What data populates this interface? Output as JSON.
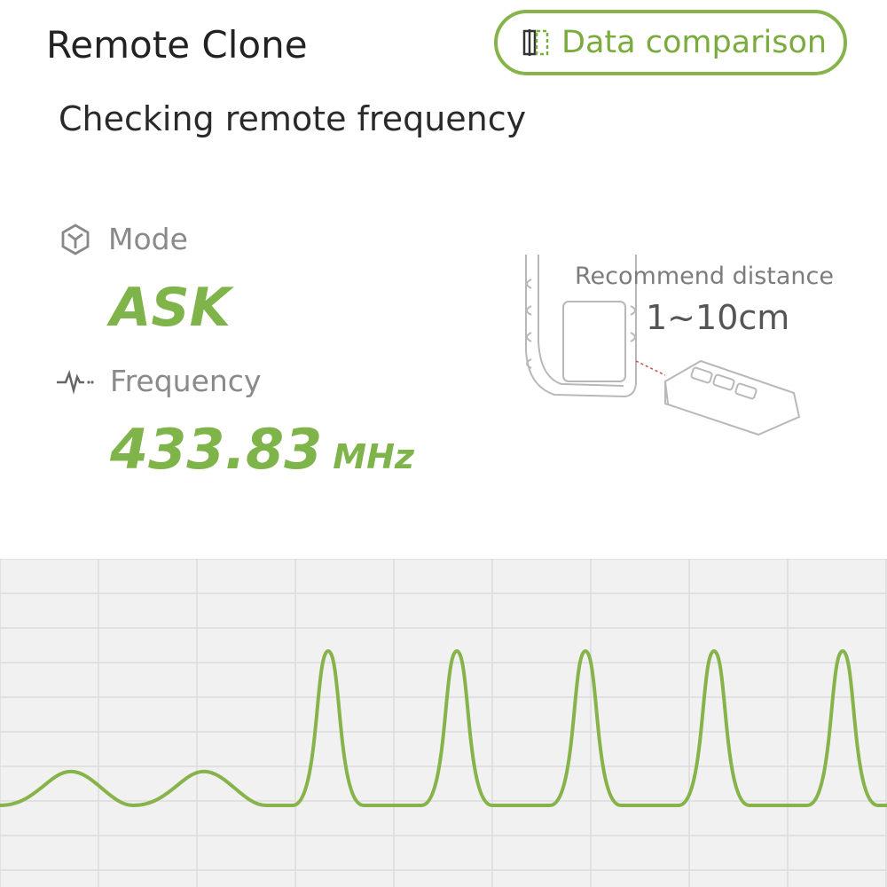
{
  "header": {
    "title": "Remote Clone",
    "compare_label": "Data comparison",
    "compare_icon": "compare-icon"
  },
  "status": {
    "text": "Checking remote frequency"
  },
  "mode": {
    "label": "Mode",
    "value": "ASK",
    "icon": "mode-cube-icon"
  },
  "frequency": {
    "label": "Frequency",
    "value": "433.83",
    "unit": "MHz",
    "icon": "waveform-icon"
  },
  "recommend": {
    "title": "Recommend distance",
    "value": "1~10cm"
  },
  "colors": {
    "accent": "#7fb44a",
    "wave": "#86b34a",
    "grid_bg": "#f1f1f1",
    "grid_line": "#dcdcdc"
  },
  "chart_data": {
    "type": "line",
    "description_values": "signal amplitude over time (relative 0-1)",
    "segments": [
      {
        "kind": "low-bump",
        "count": 2,
        "amplitude": 0.1
      },
      {
        "kind": "pulse",
        "count": 5,
        "amplitude": 1.0
      }
    ],
    "grid": true
  }
}
